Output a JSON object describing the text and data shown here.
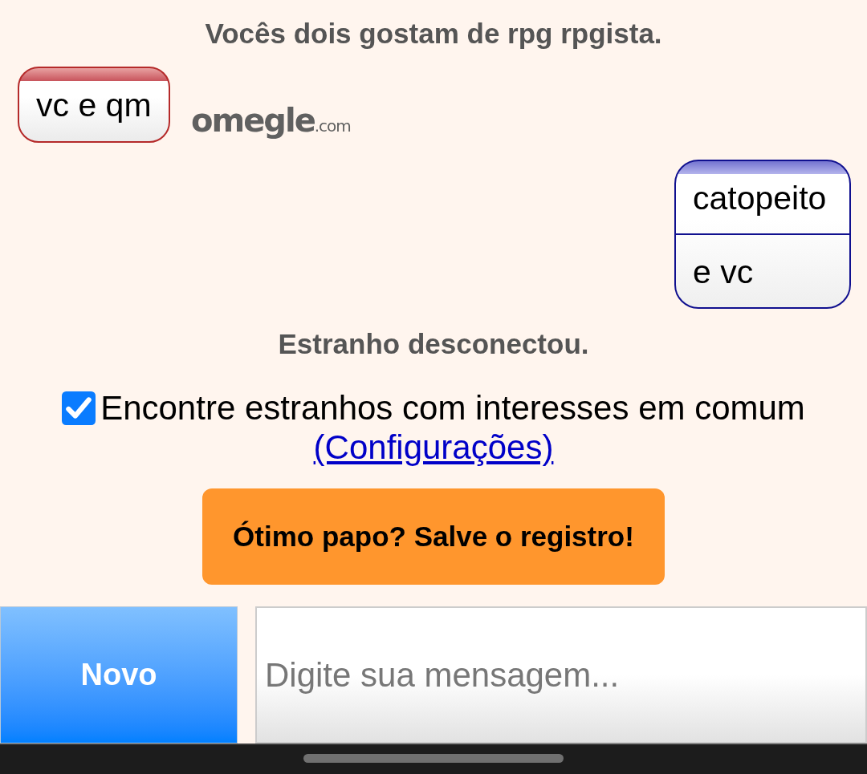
{
  "log": [
    {
      "kind": "system",
      "text": "Vocês dois gostam de rpg rpgista."
    },
    {
      "kind": "you",
      "lines": [
        "vc e qm"
      ]
    },
    {
      "kind": "stranger",
      "lines": [
        "catopeito",
        "e vc"
      ]
    },
    {
      "kind": "system",
      "text": "Estranho desconectou."
    }
  ],
  "logo": {
    "name": "omegle",
    "suffix": ".com"
  },
  "interests_option": {
    "label": "Encontre estranhos com interesses em comum",
    "checked": true,
    "link": "(Configurações)"
  },
  "save_log_button": "Ótimo papo? Salve o registro!",
  "bottom_bar": {
    "new_button": "Novo",
    "message_input": {
      "placeholder": "Digite sua mensagem..."
    }
  }
}
